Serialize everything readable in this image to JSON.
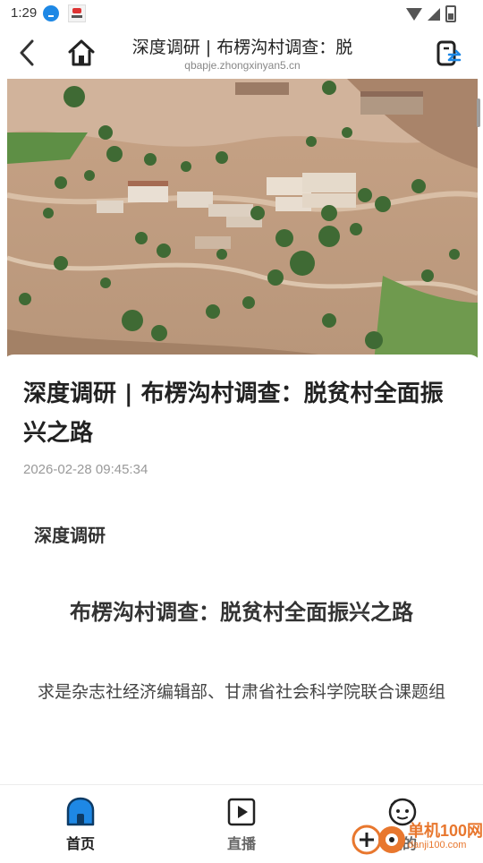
{
  "status_bar": {
    "time": "1:29",
    "icons": [
      "download-icon",
      "app-notification-icon",
      "wifi-icon",
      "signal-icon",
      "battery-icon"
    ]
  },
  "header": {
    "title": "深度调研 | 布楞沟村调查：脱",
    "url": "qbapje.zhongxinyan5.cn",
    "icons": [
      "back-arrow-icon",
      "home-icon",
      "switch-window-icon"
    ]
  },
  "article": {
    "title": "深度调研 | 布楞沟村调查：脱贫村全面振兴之路",
    "date": "2026-02-28 09:45:34",
    "section": "深度调研",
    "heading": "布楞沟村调查：脱贫村全面振兴之路",
    "byline": "求是杂志社经济编辑部、甘肃省社会科学院联合课题组"
  },
  "bottom_nav": {
    "items": [
      {
        "label": "首页",
        "icon": "home-icon"
      },
      {
        "label": "直播",
        "icon": "play-icon"
      },
      {
        "label": "我的",
        "icon": "profile-face-icon"
      }
    ]
  },
  "watermark": {
    "brand": "单机100网",
    "url": "danji100.com"
  },
  "colors": {
    "accent": "#1e88e5",
    "watermark": "#e8772e",
    "date_text": "#999999"
  }
}
